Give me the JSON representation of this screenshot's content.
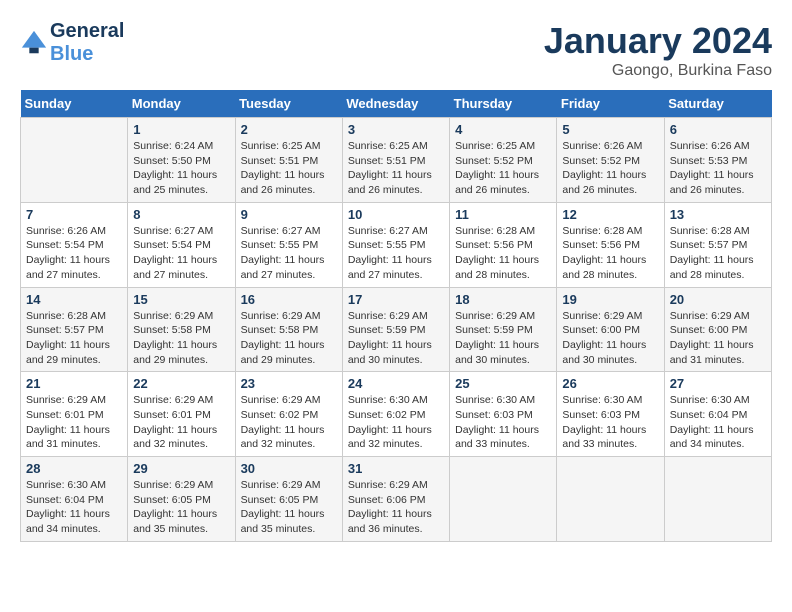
{
  "header": {
    "logo_line1": "General",
    "logo_line2": "Blue",
    "main_title": "January 2024",
    "sub_title": "Gaongo, Burkina Faso"
  },
  "calendar": {
    "days_of_week": [
      "Sunday",
      "Monday",
      "Tuesday",
      "Wednesday",
      "Thursday",
      "Friday",
      "Saturday"
    ],
    "weeks": [
      [
        {
          "day": "",
          "sunrise": "",
          "sunset": "",
          "daylight": ""
        },
        {
          "day": "1",
          "sunrise": "Sunrise: 6:24 AM",
          "sunset": "Sunset: 5:50 PM",
          "daylight": "Daylight: 11 hours and 25 minutes."
        },
        {
          "day": "2",
          "sunrise": "Sunrise: 6:25 AM",
          "sunset": "Sunset: 5:51 PM",
          "daylight": "Daylight: 11 hours and 26 minutes."
        },
        {
          "day": "3",
          "sunrise": "Sunrise: 6:25 AM",
          "sunset": "Sunset: 5:51 PM",
          "daylight": "Daylight: 11 hours and 26 minutes."
        },
        {
          "day": "4",
          "sunrise": "Sunrise: 6:25 AM",
          "sunset": "Sunset: 5:52 PM",
          "daylight": "Daylight: 11 hours and 26 minutes."
        },
        {
          "day": "5",
          "sunrise": "Sunrise: 6:26 AM",
          "sunset": "Sunset: 5:52 PM",
          "daylight": "Daylight: 11 hours and 26 minutes."
        },
        {
          "day": "6",
          "sunrise": "Sunrise: 6:26 AM",
          "sunset": "Sunset: 5:53 PM",
          "daylight": "Daylight: 11 hours and 26 minutes."
        }
      ],
      [
        {
          "day": "7",
          "sunrise": "Sunrise: 6:26 AM",
          "sunset": "Sunset: 5:54 PM",
          "daylight": "Daylight: 11 hours and 27 minutes."
        },
        {
          "day": "8",
          "sunrise": "Sunrise: 6:27 AM",
          "sunset": "Sunset: 5:54 PM",
          "daylight": "Daylight: 11 hours and 27 minutes."
        },
        {
          "day": "9",
          "sunrise": "Sunrise: 6:27 AM",
          "sunset": "Sunset: 5:55 PM",
          "daylight": "Daylight: 11 hours and 27 minutes."
        },
        {
          "day": "10",
          "sunrise": "Sunrise: 6:27 AM",
          "sunset": "Sunset: 5:55 PM",
          "daylight": "Daylight: 11 hours and 27 minutes."
        },
        {
          "day": "11",
          "sunrise": "Sunrise: 6:28 AM",
          "sunset": "Sunset: 5:56 PM",
          "daylight": "Daylight: 11 hours and 28 minutes."
        },
        {
          "day": "12",
          "sunrise": "Sunrise: 6:28 AM",
          "sunset": "Sunset: 5:56 PM",
          "daylight": "Daylight: 11 hours and 28 minutes."
        },
        {
          "day": "13",
          "sunrise": "Sunrise: 6:28 AM",
          "sunset": "Sunset: 5:57 PM",
          "daylight": "Daylight: 11 hours and 28 minutes."
        }
      ],
      [
        {
          "day": "14",
          "sunrise": "Sunrise: 6:28 AM",
          "sunset": "Sunset: 5:57 PM",
          "daylight": "Daylight: 11 hours and 29 minutes."
        },
        {
          "day": "15",
          "sunrise": "Sunrise: 6:29 AM",
          "sunset": "Sunset: 5:58 PM",
          "daylight": "Daylight: 11 hours and 29 minutes."
        },
        {
          "day": "16",
          "sunrise": "Sunrise: 6:29 AM",
          "sunset": "Sunset: 5:58 PM",
          "daylight": "Daylight: 11 hours and 29 minutes."
        },
        {
          "day": "17",
          "sunrise": "Sunrise: 6:29 AM",
          "sunset": "Sunset: 5:59 PM",
          "daylight": "Daylight: 11 hours and 30 minutes."
        },
        {
          "day": "18",
          "sunrise": "Sunrise: 6:29 AM",
          "sunset": "Sunset: 5:59 PM",
          "daylight": "Daylight: 11 hours and 30 minutes."
        },
        {
          "day": "19",
          "sunrise": "Sunrise: 6:29 AM",
          "sunset": "Sunset: 6:00 PM",
          "daylight": "Daylight: 11 hours and 30 minutes."
        },
        {
          "day": "20",
          "sunrise": "Sunrise: 6:29 AM",
          "sunset": "Sunset: 6:00 PM",
          "daylight": "Daylight: 11 hours and 31 minutes."
        }
      ],
      [
        {
          "day": "21",
          "sunrise": "Sunrise: 6:29 AM",
          "sunset": "Sunset: 6:01 PM",
          "daylight": "Daylight: 11 hours and 31 minutes."
        },
        {
          "day": "22",
          "sunrise": "Sunrise: 6:29 AM",
          "sunset": "Sunset: 6:01 PM",
          "daylight": "Daylight: 11 hours and 32 minutes."
        },
        {
          "day": "23",
          "sunrise": "Sunrise: 6:29 AM",
          "sunset": "Sunset: 6:02 PM",
          "daylight": "Daylight: 11 hours and 32 minutes."
        },
        {
          "day": "24",
          "sunrise": "Sunrise: 6:30 AM",
          "sunset": "Sunset: 6:02 PM",
          "daylight": "Daylight: 11 hours and 32 minutes."
        },
        {
          "day": "25",
          "sunrise": "Sunrise: 6:30 AM",
          "sunset": "Sunset: 6:03 PM",
          "daylight": "Daylight: 11 hours and 33 minutes."
        },
        {
          "day": "26",
          "sunrise": "Sunrise: 6:30 AM",
          "sunset": "Sunset: 6:03 PM",
          "daylight": "Daylight: 11 hours and 33 minutes."
        },
        {
          "day": "27",
          "sunrise": "Sunrise: 6:30 AM",
          "sunset": "Sunset: 6:04 PM",
          "daylight": "Daylight: 11 hours and 34 minutes."
        }
      ],
      [
        {
          "day": "28",
          "sunrise": "Sunrise: 6:30 AM",
          "sunset": "Sunset: 6:04 PM",
          "daylight": "Daylight: 11 hours and 34 minutes."
        },
        {
          "day": "29",
          "sunrise": "Sunrise: 6:29 AM",
          "sunset": "Sunset: 6:05 PM",
          "daylight": "Daylight: 11 hours and 35 minutes."
        },
        {
          "day": "30",
          "sunrise": "Sunrise: 6:29 AM",
          "sunset": "Sunset: 6:05 PM",
          "daylight": "Daylight: 11 hours and 35 minutes."
        },
        {
          "day": "31",
          "sunrise": "Sunrise: 6:29 AM",
          "sunset": "Sunset: 6:06 PM",
          "daylight": "Daylight: 11 hours and 36 minutes."
        },
        {
          "day": "",
          "sunrise": "",
          "sunset": "",
          "daylight": ""
        },
        {
          "day": "",
          "sunrise": "",
          "sunset": "",
          "daylight": ""
        },
        {
          "day": "",
          "sunrise": "",
          "sunset": "",
          "daylight": ""
        }
      ]
    ]
  }
}
